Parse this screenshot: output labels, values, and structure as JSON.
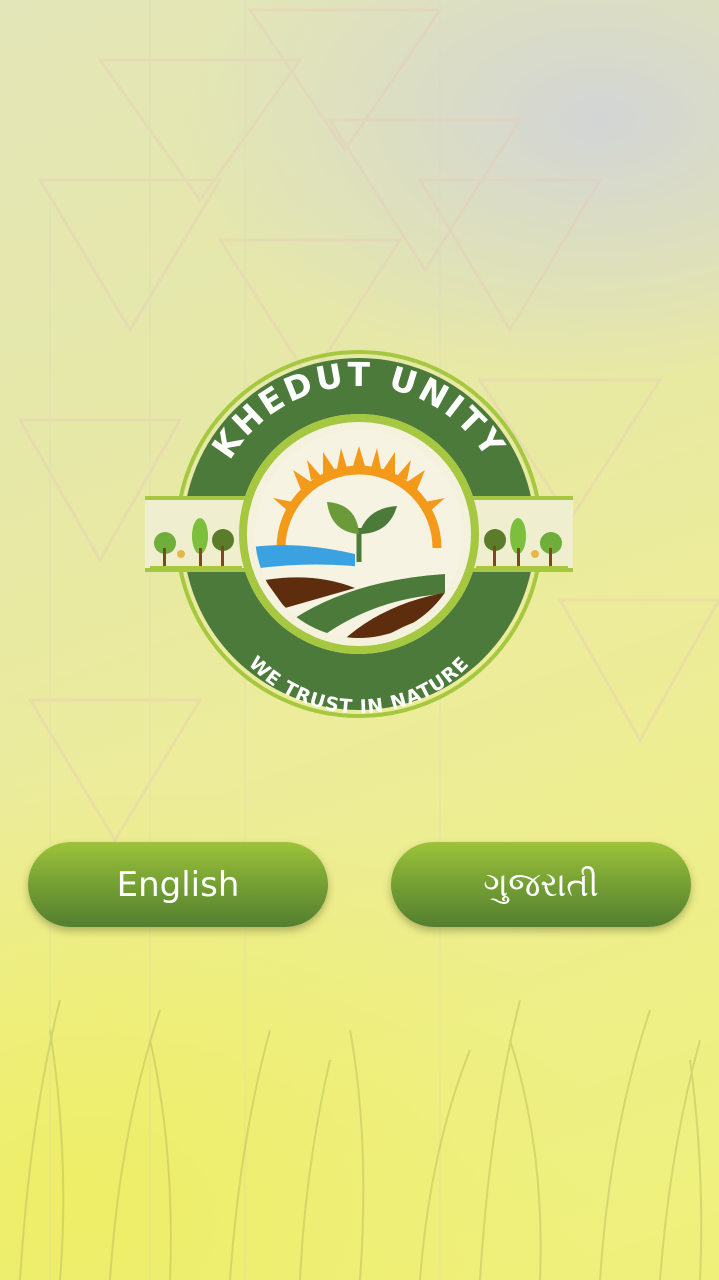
{
  "logo": {
    "title": "KHEDUT UNITY",
    "tagline": "WE TRUST IN NATURE"
  },
  "buttons": {
    "english_label": "English",
    "gujarati_label": "ગુજરાતી"
  },
  "colors": {
    "ring_dark_green": "#4c7a3a",
    "ring_light_green": "#a5c840",
    "sun_orange": "#f49a1a",
    "soil_brown": "#5e2d0e",
    "water_blue": "#3aa2e0",
    "button_top": "#9ec33a",
    "button_bottom": "#537f30"
  }
}
